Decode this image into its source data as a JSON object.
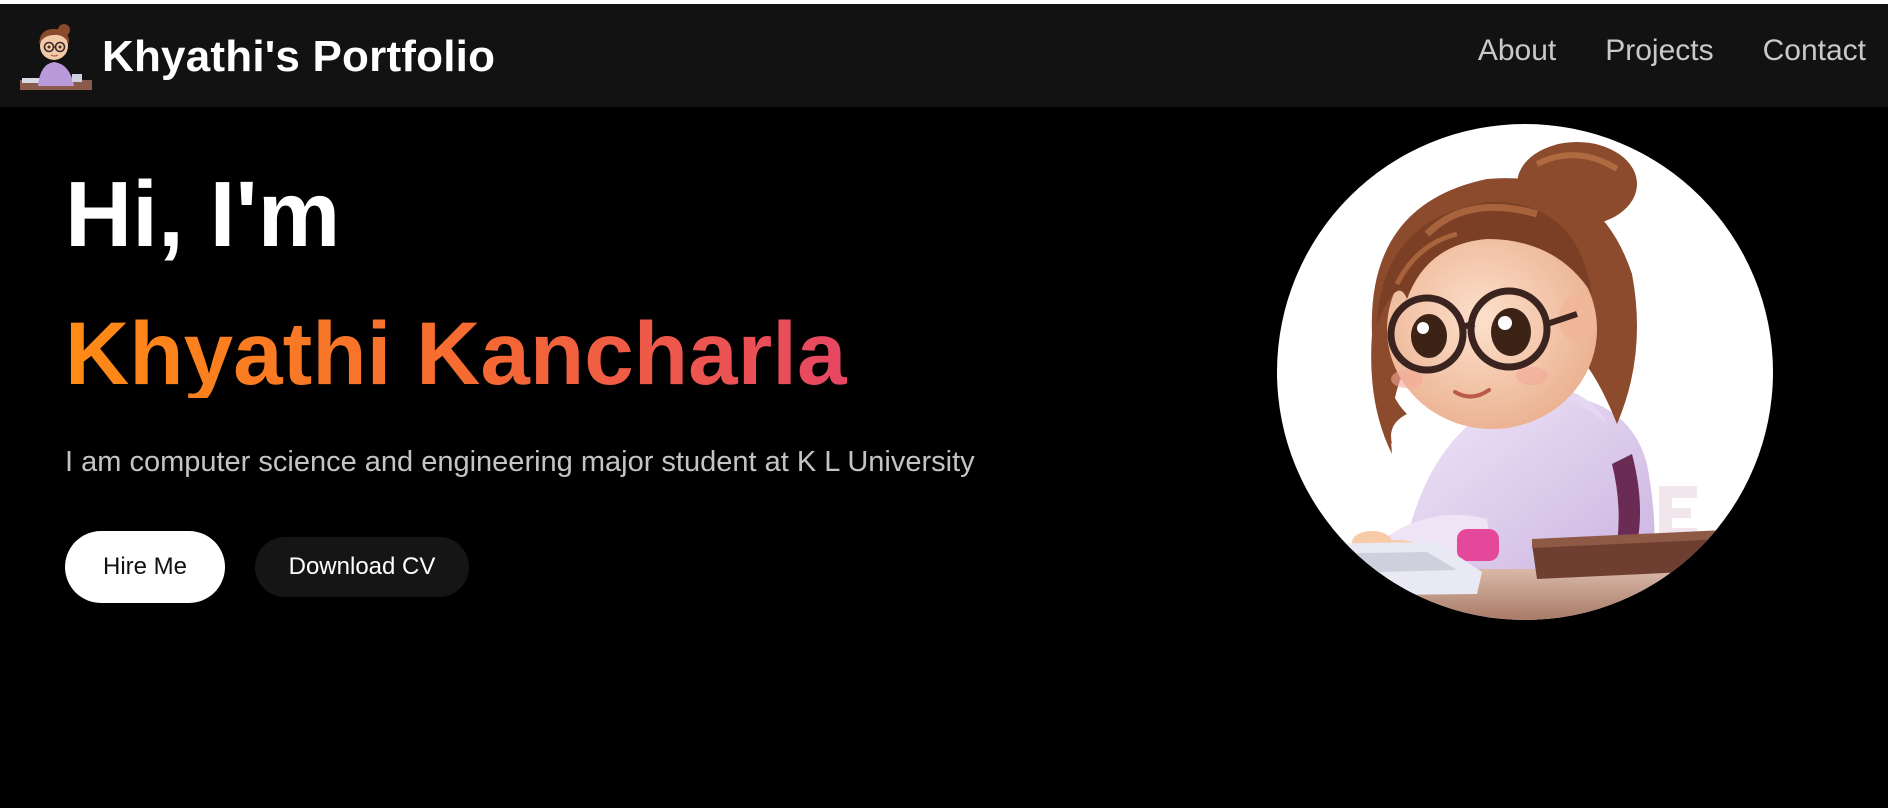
{
  "nav": {
    "brand_title": "Khyathi's Portfolio",
    "logo_icon": "avatar-girl-logo",
    "links": [
      {
        "label": "About"
      },
      {
        "label": "Projects"
      },
      {
        "label": "Contact"
      }
    ]
  },
  "hero": {
    "greeting": "Hi, I'm",
    "name": "Khyathi Kancharla",
    "tagline": "I am computer science and engineering major student at K L University",
    "hire_button": "Hire Me",
    "cv_button": "Download CV",
    "avatar_icon": "girl-at-desk-illustration"
  },
  "colors": {
    "background": "#000000",
    "navbar": "#121212",
    "name_gradient_start": "#ff8b14",
    "name_gradient_end": "#e13b73",
    "nav_link": "#c9c9c9",
    "tagline": "#c4c4c4"
  }
}
